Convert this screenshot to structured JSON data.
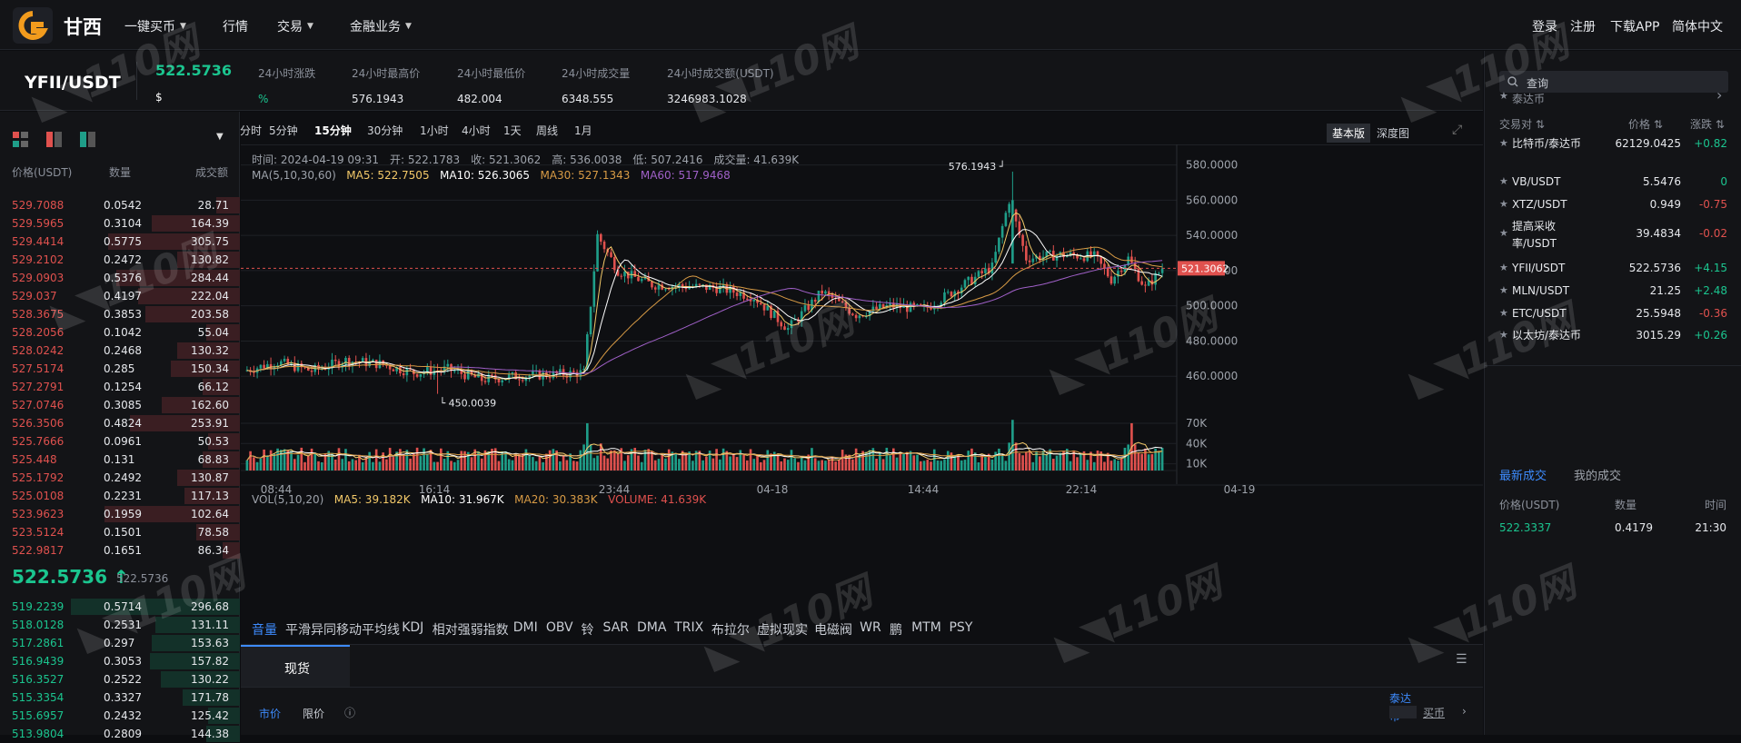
{
  "header": {
    "brand": "甘西",
    "nav": [
      {
        "label": "一键买币",
        "caret": true
      },
      {
        "label": "行情",
        "caret": false
      },
      {
        "label": "交易",
        "caret": true
      },
      {
        "label": "金融业务",
        "caret": true
      }
    ],
    "right": [
      "登录",
      "注册",
      "下载APP",
      "简体中文"
    ]
  },
  "ticker": {
    "pair": "YFII/USDT",
    "price": "522.5736",
    "price_unit": "$",
    "stats": [
      {
        "label": "24小时涨跌",
        "value": "%"
      },
      {
        "label": "24小时最高价",
        "value": "576.1943"
      },
      {
        "label": "24小时最低价",
        "value": "482.004"
      },
      {
        "label": "24小时成交量",
        "value": "6348.555"
      },
      {
        "label": "24小时成交额(USDT)",
        "value": "3246983.1028"
      }
    ]
  },
  "orderbook": {
    "headers": [
      "价格(USDT)",
      "数量",
      "成交额"
    ],
    "asks": [
      {
        "price": "529.7088",
        "qty": "0.0542",
        "total": "28.71",
        "depth": 0.14
      },
      {
        "price": "529.5965",
        "qty": "0.3104",
        "total": "164.39",
        "depth": 0.52
      },
      {
        "price": "529.4414",
        "qty": "0.5775",
        "total": "305.75",
        "depth": 0.78
      },
      {
        "price": "529.2102",
        "qty": "0.2472",
        "total": "130.82",
        "depth": 0.37
      },
      {
        "price": "529.0903",
        "qty": "0.5376",
        "total": "284.44",
        "depth": 0.73
      },
      {
        "price": "529.037",
        "qty": "0.4197",
        "total": "222.04",
        "depth": 0.6
      },
      {
        "price": "528.3675",
        "qty": "0.3853",
        "total": "203.58",
        "depth": 0.56
      },
      {
        "price": "528.2056",
        "qty": "0.1042",
        "total": "55.04",
        "depth": 0.2
      },
      {
        "price": "528.0242",
        "qty": "0.2468",
        "total": "130.32",
        "depth": 0.37
      },
      {
        "price": "527.5174",
        "qty": "0.285",
        "total": "150.34",
        "depth": 0.41
      },
      {
        "price": "527.2791",
        "qty": "0.1254",
        "total": "66.12",
        "depth": 0.22
      },
      {
        "price": "527.0746",
        "qty": "0.3085",
        "total": "162.60",
        "depth": 0.46
      },
      {
        "price": "526.3506",
        "qty": "0.4824",
        "total": "253.91",
        "depth": 0.65
      },
      {
        "price": "525.7666",
        "qty": "0.0961",
        "total": "50.53",
        "depth": 0.19
      },
      {
        "price": "525.448",
        "qty": "0.131",
        "total": "68.83",
        "depth": 0.22
      },
      {
        "price": "525.1792",
        "qty": "0.2492",
        "total": "130.87",
        "depth": 0.37
      },
      {
        "price": "525.0108",
        "qty": "0.2231",
        "total": "117.13",
        "depth": 0.33
      },
      {
        "price": "523.9623",
        "qty": "0.1959",
        "total": "102.64",
        "depth": 0.8
      },
      {
        "price": "523.5124",
        "qty": "0.1501",
        "total": "78.58",
        "depth": 0.26
      },
      {
        "price": "522.9817",
        "qty": "0.1651",
        "total": "86.34",
        "depth": 0.1
      }
    ],
    "last_price": "522.5736",
    "last_arrow": "↑",
    "last_sub": "522.5736",
    "bids": [
      {
        "price": "519.2239",
        "qty": "0.5714",
        "total": "296.68",
        "depth": 1.0
      },
      {
        "price": "518.0128",
        "qty": "0.2531",
        "total": "131.11",
        "depth": 0.5
      },
      {
        "price": "517.2861",
        "qty": "0.297",
        "total": "153.63",
        "depth": 0.52
      },
      {
        "price": "516.9439",
        "qty": "0.3053",
        "total": "157.82",
        "depth": 0.53
      },
      {
        "price": "516.3527",
        "qty": "0.2522",
        "total": "130.22",
        "depth": 0.47
      },
      {
        "price": "515.3354",
        "qty": "0.3327",
        "total": "171.78",
        "depth": 0.34
      },
      {
        "price": "515.6957",
        "qty": "0.2432",
        "total": "125.42",
        "depth": 0.19
      },
      {
        "price": "513.9804",
        "qty": "0.2809",
        "total": "144.38",
        "depth": 0.2
      }
    ]
  },
  "chart": {
    "timeframes": [
      "分时",
      "5分钟",
      "15分钟",
      "30分钟",
      "1小时",
      "4小时",
      "1天",
      "周线",
      "1月"
    ],
    "active_timeframe": "15分钟",
    "view_buttons": [
      "基本版",
      "深度图"
    ],
    "active_view": "基本版",
    "info_line": "时间: 2024-04-19 09:31　开: 522.1783　收: 521.3062　高: 536.0038　低: 507.2416　成交量: 41.639K",
    "ma_label": "MA(5,10,30,60)",
    "ma5": "MA5: 522.7505",
    "ma10": "MA10: 526.3065",
    "ma30": "MA30: 527.1343",
    "ma60": "MA60: 517.9468",
    "vol_label": "VOL(5,10,20)",
    "vol_ma5": "MA5: 39.182K",
    "vol_ma10": "MA10: 31.967K",
    "vol_ma20": "MA20: 30.383K",
    "vol_cur": "VOLUME: 41.639K",
    "price_axis": [
      "580.0000",
      "560.0000",
      "540.0000",
      "520.0000",
      "500.0000",
      "480.0000",
      "460.0000"
    ],
    "price_range": [
      440,
      587
    ],
    "current_price": "521.3062",
    "high_label": "576.1943",
    "low_label": "450.0039",
    "vol_axis": [
      "70K",
      "40K",
      "10K"
    ],
    "time_axis": [
      "08:44",
      "16:14",
      "23:44",
      "04-18",
      "14:44",
      "22:14",
      "04-19"
    ],
    "indicators": [
      "音量",
      "平滑异同移动平均线",
      "KDJ",
      "相对强弱指数",
      "DMI",
      "OBV",
      "铃",
      "SAR",
      "DMA",
      "TRIX",
      "布拉尔",
      "虚拟现实",
      "电磁阀",
      "WR",
      "鹏",
      "MTM",
      "PSY"
    ],
    "active_indicator": "音量",
    "colors": {
      "up": "#1f9e89",
      "down": "#e0514e",
      "ma5": "#f3c969",
      "ma10": "#ffffff",
      "ma30": "#d89b45",
      "ma60": "#a060c8"
    }
  },
  "chart_data": {
    "type": "candlestick",
    "anchors": [
      [
        0,
        463
      ],
      [
        10,
        468
      ],
      [
        20,
        463
      ],
      [
        30,
        469
      ],
      [
        40,
        467
      ],
      [
        50,
        462
      ],
      [
        60,
        464
      ],
      [
        70,
        458
      ],
      [
        80,
        460
      ],
      [
        100,
        462
      ],
      [
        104,
        540
      ],
      [
        110,
        520
      ],
      [
        120,
        512
      ],
      [
        140,
        510
      ],
      [
        150,
        505
      ],
      [
        160,
        487
      ],
      [
        170,
        508
      ],
      [
        180,
        495
      ],
      [
        190,
        500
      ],
      [
        200,
        498
      ],
      [
        210,
        510
      ],
      [
        220,
        522
      ],
      [
        225,
        560
      ],
      [
        230,
        527
      ],
      [
        240,
        529
      ],
      [
        250,
        528
      ],
      [
        255,
        515
      ],
      [
        260,
        527
      ],
      [
        265,
        510
      ],
      [
        270,
        521
      ]
    ],
    "volume_peaks": [
      [
        100,
        70
      ],
      [
        104,
        40
      ],
      [
        225,
        75
      ],
      [
        260,
        70
      ]
    ],
    "high": 576.1943,
    "low": 450.0039,
    "current": 521.3062
  },
  "trade_bar": {
    "tab": "现货",
    "order_types": [
      "市价",
      "限价"
    ],
    "pair_parts": [
      "泰达",
      "币"
    ],
    "buy": "买币"
  },
  "market": {
    "search_placeholder": "查询",
    "group": "泰达币",
    "headers": [
      "交易对",
      "价格",
      "涨跌"
    ],
    "rows": [
      {
        "name": "比特币/泰达币",
        "price": "62129.0425",
        "change": "+0.82",
        "dir": "up"
      },
      {
        "name": "VB/USDT",
        "price": "5.5476",
        "change": "0",
        "dir": "up"
      },
      {
        "name": "XTZ/USDT",
        "price": "0.949",
        "change": "-0.75",
        "dir": "down"
      },
      {
        "name": "提高采收率/USDT",
        "price": "39.4834",
        "change": "-0.02",
        "dir": "down"
      },
      {
        "name": "YFII/USDT",
        "price": "522.5736",
        "change": "+4.15",
        "dir": "up"
      },
      {
        "name": "MLN/USDT",
        "price": "21.25",
        "change": "+2.48",
        "dir": "up"
      },
      {
        "name": "ETC/USDT",
        "price": "25.5948",
        "change": "-0.36",
        "dir": "down"
      },
      {
        "name": "以太坊/泰达币",
        "price": "3015.29",
        "change": "+0.26",
        "dir": "up"
      }
    ]
  },
  "trades": {
    "tabs": [
      "最新成交",
      "我的成交"
    ],
    "active_tab": "最新成交",
    "headers": [
      "价格(USDT)",
      "数量",
      "时间"
    ],
    "rows": [
      {
        "price": "522.3337",
        "qty": "0.4179",
        "time": "21:30"
      }
    ]
  },
  "watermark": "110网"
}
